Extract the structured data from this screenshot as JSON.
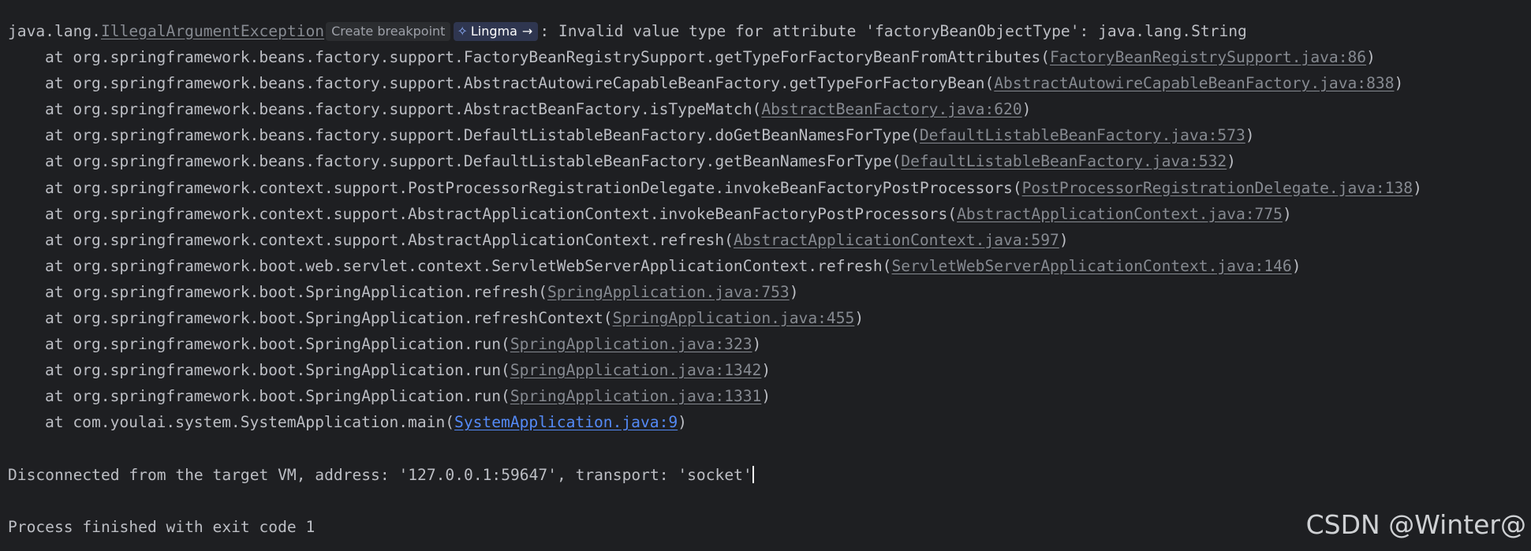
{
  "exception": {
    "prefix": "java.lang.",
    "class_link": "IllegalArgumentException",
    "breakpoint_chip": "Create breakpoint",
    "lingma_chip": {
      "icon": "lingma-icon",
      "label": "Lingma",
      "arrow": "→"
    },
    "message": ": Invalid value type for attribute 'factoryBeanObjectType': java.lang.String"
  },
  "frames": [
    {
      "method": "at org.springframework.beans.factory.support.FactoryBeanRegistrySupport.getTypeForFactoryBeanFromAttributes(",
      "location": "FactoryBeanRegistrySupport.java:86",
      "close": ")"
    },
    {
      "method": "at org.springframework.beans.factory.support.AbstractAutowireCapableBeanFactory.getTypeForFactoryBean(",
      "location": "AbstractAutowireCapableBeanFactory.java:838",
      "close": ")"
    },
    {
      "method": "at org.springframework.beans.factory.support.AbstractBeanFactory.isTypeMatch(",
      "location": "AbstractBeanFactory.java:620",
      "close": ")"
    },
    {
      "method": "at org.springframework.beans.factory.support.DefaultListableBeanFactory.doGetBeanNamesForType(",
      "location": "DefaultListableBeanFactory.java:573",
      "close": ")"
    },
    {
      "method": "at org.springframework.beans.factory.support.DefaultListableBeanFactory.getBeanNamesForType(",
      "location": "DefaultListableBeanFactory.java:532",
      "close": ")"
    },
    {
      "method": "at org.springframework.context.support.PostProcessorRegistrationDelegate.invokeBeanFactoryPostProcessors(",
      "location": "PostProcessorRegistrationDelegate.java:138",
      "close": ")"
    },
    {
      "method": "at org.springframework.context.support.AbstractApplicationContext.invokeBeanFactoryPostProcessors(",
      "location": "AbstractApplicationContext.java:775",
      "close": ")"
    },
    {
      "method": "at org.springframework.context.support.AbstractApplicationContext.refresh(",
      "location": "AbstractApplicationContext.java:597",
      "close": ")"
    },
    {
      "method": "at org.springframework.boot.web.servlet.context.ServletWebServerApplicationContext.refresh(",
      "location": "ServletWebServerApplicationContext.java:146",
      "close": ")"
    },
    {
      "method": "at org.springframework.boot.SpringApplication.refresh(",
      "location": "SpringApplication.java:753",
      "close": ")"
    },
    {
      "method": "at org.springframework.boot.SpringApplication.refreshContext(",
      "location": "SpringApplication.java:455",
      "close": ")"
    },
    {
      "method": "at org.springframework.boot.SpringApplication.run(",
      "location": "SpringApplication.java:323",
      "close": ")"
    },
    {
      "method": "at org.springframework.boot.SpringApplication.run(",
      "location": "SpringApplication.java:1342",
      "close": ")"
    },
    {
      "method": "at org.springframework.boot.SpringApplication.run(",
      "location": "SpringApplication.java:1331",
      "close": ")"
    },
    {
      "method": "at com.youlai.system.SystemApplication.main(",
      "location": "SystemApplication.java:9",
      "close": ")"
    }
  ],
  "disconnect_text": "Disconnected from the target VM, address: '127.0.0.1:59647', transport: 'socket'",
  "process_text": "Process finished with exit code 1",
  "watermark": "CSDN @Winter@",
  "colors": {
    "background": "#1e1f22",
    "text": "#bcbec4",
    "library_link": "#868a91",
    "user_link": "#548af7"
  }
}
